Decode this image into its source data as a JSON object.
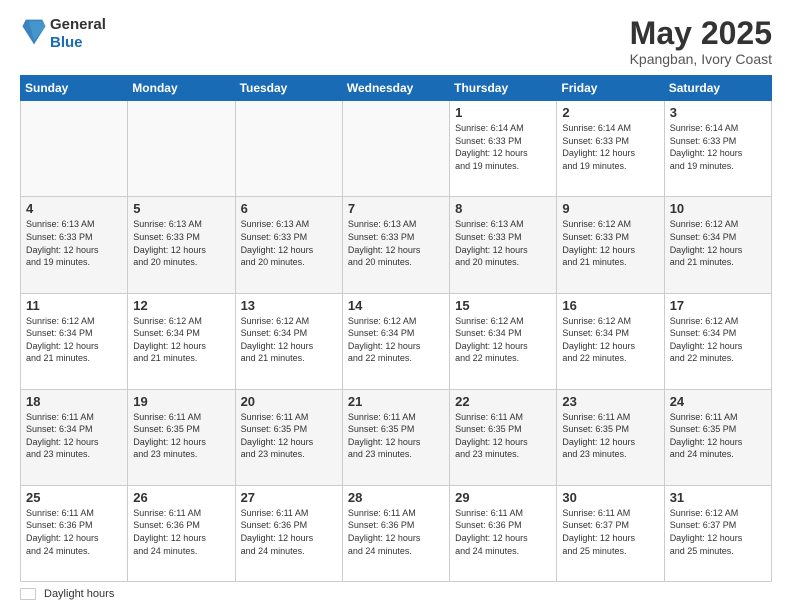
{
  "logo": {
    "line1": "General",
    "line2": "Blue"
  },
  "title": "May 2025",
  "location": "Kpangban, Ivory Coast",
  "days_of_week": [
    "Sunday",
    "Monday",
    "Tuesday",
    "Wednesday",
    "Thursday",
    "Friday",
    "Saturday"
  ],
  "footer_label": "Daylight hours",
  "weeks": [
    [
      {
        "day": "",
        "info": ""
      },
      {
        "day": "",
        "info": ""
      },
      {
        "day": "",
        "info": ""
      },
      {
        "day": "",
        "info": ""
      },
      {
        "day": "1",
        "info": "Sunrise: 6:14 AM\nSunset: 6:33 PM\nDaylight: 12 hours\nand 19 minutes."
      },
      {
        "day": "2",
        "info": "Sunrise: 6:14 AM\nSunset: 6:33 PM\nDaylight: 12 hours\nand 19 minutes."
      },
      {
        "day": "3",
        "info": "Sunrise: 6:14 AM\nSunset: 6:33 PM\nDaylight: 12 hours\nand 19 minutes."
      }
    ],
    [
      {
        "day": "4",
        "info": "Sunrise: 6:13 AM\nSunset: 6:33 PM\nDaylight: 12 hours\nand 19 minutes."
      },
      {
        "day": "5",
        "info": "Sunrise: 6:13 AM\nSunset: 6:33 PM\nDaylight: 12 hours\nand 20 minutes."
      },
      {
        "day": "6",
        "info": "Sunrise: 6:13 AM\nSunset: 6:33 PM\nDaylight: 12 hours\nand 20 minutes."
      },
      {
        "day": "7",
        "info": "Sunrise: 6:13 AM\nSunset: 6:33 PM\nDaylight: 12 hours\nand 20 minutes."
      },
      {
        "day": "8",
        "info": "Sunrise: 6:13 AM\nSunset: 6:33 PM\nDaylight: 12 hours\nand 20 minutes."
      },
      {
        "day": "9",
        "info": "Sunrise: 6:12 AM\nSunset: 6:33 PM\nDaylight: 12 hours\nand 21 minutes."
      },
      {
        "day": "10",
        "info": "Sunrise: 6:12 AM\nSunset: 6:34 PM\nDaylight: 12 hours\nand 21 minutes."
      }
    ],
    [
      {
        "day": "11",
        "info": "Sunrise: 6:12 AM\nSunset: 6:34 PM\nDaylight: 12 hours\nand 21 minutes."
      },
      {
        "day": "12",
        "info": "Sunrise: 6:12 AM\nSunset: 6:34 PM\nDaylight: 12 hours\nand 21 minutes."
      },
      {
        "day": "13",
        "info": "Sunrise: 6:12 AM\nSunset: 6:34 PM\nDaylight: 12 hours\nand 21 minutes."
      },
      {
        "day": "14",
        "info": "Sunrise: 6:12 AM\nSunset: 6:34 PM\nDaylight: 12 hours\nand 22 minutes."
      },
      {
        "day": "15",
        "info": "Sunrise: 6:12 AM\nSunset: 6:34 PM\nDaylight: 12 hours\nand 22 minutes."
      },
      {
        "day": "16",
        "info": "Sunrise: 6:12 AM\nSunset: 6:34 PM\nDaylight: 12 hours\nand 22 minutes."
      },
      {
        "day": "17",
        "info": "Sunrise: 6:12 AM\nSunset: 6:34 PM\nDaylight: 12 hours\nand 22 minutes."
      }
    ],
    [
      {
        "day": "18",
        "info": "Sunrise: 6:11 AM\nSunset: 6:34 PM\nDaylight: 12 hours\nand 23 minutes."
      },
      {
        "day": "19",
        "info": "Sunrise: 6:11 AM\nSunset: 6:35 PM\nDaylight: 12 hours\nand 23 minutes."
      },
      {
        "day": "20",
        "info": "Sunrise: 6:11 AM\nSunset: 6:35 PM\nDaylight: 12 hours\nand 23 minutes."
      },
      {
        "day": "21",
        "info": "Sunrise: 6:11 AM\nSunset: 6:35 PM\nDaylight: 12 hours\nand 23 minutes."
      },
      {
        "day": "22",
        "info": "Sunrise: 6:11 AM\nSunset: 6:35 PM\nDaylight: 12 hours\nand 23 minutes."
      },
      {
        "day": "23",
        "info": "Sunrise: 6:11 AM\nSunset: 6:35 PM\nDaylight: 12 hours\nand 23 minutes."
      },
      {
        "day": "24",
        "info": "Sunrise: 6:11 AM\nSunset: 6:35 PM\nDaylight: 12 hours\nand 24 minutes."
      }
    ],
    [
      {
        "day": "25",
        "info": "Sunrise: 6:11 AM\nSunset: 6:36 PM\nDaylight: 12 hours\nand 24 minutes."
      },
      {
        "day": "26",
        "info": "Sunrise: 6:11 AM\nSunset: 6:36 PM\nDaylight: 12 hours\nand 24 minutes."
      },
      {
        "day": "27",
        "info": "Sunrise: 6:11 AM\nSunset: 6:36 PM\nDaylight: 12 hours\nand 24 minutes."
      },
      {
        "day": "28",
        "info": "Sunrise: 6:11 AM\nSunset: 6:36 PM\nDaylight: 12 hours\nand 24 minutes."
      },
      {
        "day": "29",
        "info": "Sunrise: 6:11 AM\nSunset: 6:36 PM\nDaylight: 12 hours\nand 24 minutes."
      },
      {
        "day": "30",
        "info": "Sunrise: 6:11 AM\nSunset: 6:37 PM\nDaylight: 12 hours\nand 25 minutes."
      },
      {
        "day": "31",
        "info": "Sunrise: 6:12 AM\nSunset: 6:37 PM\nDaylight: 12 hours\nand 25 minutes."
      }
    ]
  ]
}
